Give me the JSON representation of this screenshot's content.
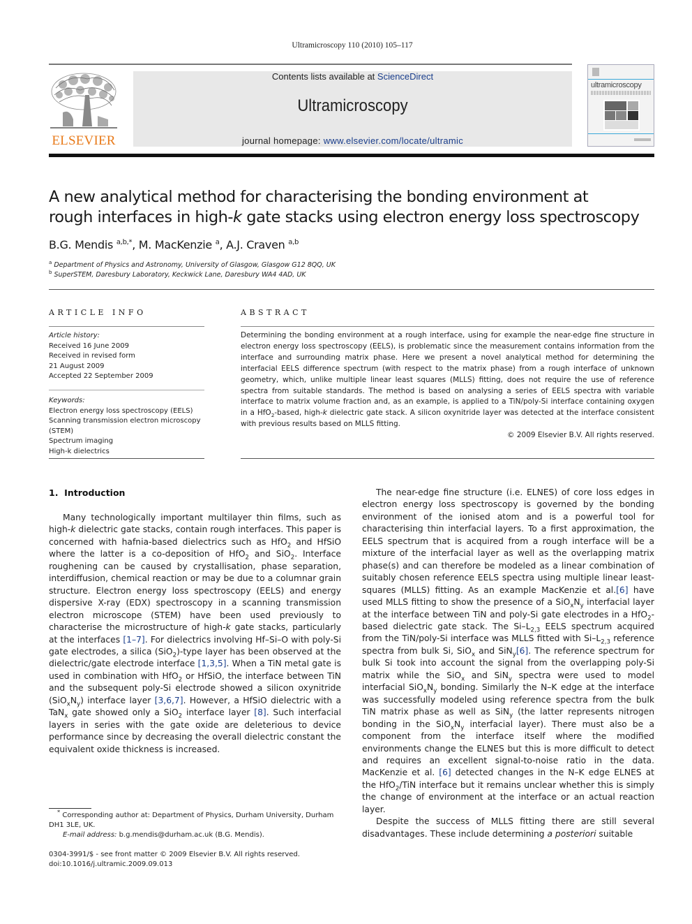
{
  "header": {
    "citation": "Ultramicroscopy 110 (2010) 105–117",
    "contents_prefix": "Contents lists available at ",
    "contents_link": "ScienceDirect",
    "journal_name": "Ultramicroscopy",
    "homepage_prefix": "journal homepage: ",
    "homepage_link": "www.elsevier.com/locate/ultramic",
    "publisher_logo_text": "ELSEVIER",
    "cover_title": "ultramicroscopy",
    "colors": {
      "link": "#1a3e8c",
      "elsevier_orange": "#e87a1a",
      "header_box": "#e8e8e8"
    }
  },
  "article": {
    "title_line1": "A new analytical method for characterising the bonding environment at",
    "title_line2_pre": "rough interfaces in high-",
    "title_line2_k": "k",
    "title_line2_post": " gate stacks using electron energy loss spectroscopy",
    "authors": [
      {
        "name": "B.G. Mendis",
        "sup": "a,b,*"
      },
      {
        "name": "M. MacKenzie",
        "sup": "a"
      },
      {
        "name": "A.J. Craven",
        "sup": "a,b"
      }
    ],
    "affiliations": [
      {
        "mark": "a",
        "text": "Department of Physics and Astronomy, University of Glasgow, Glasgow G12 8QQ, UK"
      },
      {
        "mark": "b",
        "text": "SuperSTEM, Daresbury Laboratory, Keckwick Lane, Daresbury WA4 4AD, UK"
      }
    ]
  },
  "article_info": {
    "heading": "ARTICLE INFO",
    "history_label": "Article history:",
    "history": [
      "Received 16 June 2009",
      "Received in revised form",
      "21 August 2009",
      "Accepted 22 September 2009"
    ],
    "keywords_label": "Keywords:",
    "keywords": [
      "Electron energy loss spectroscopy (EELS)",
      "Scanning transmission electron microscopy",
      "(STEM)",
      "Spectrum imaging",
      "High-k dielectrics"
    ]
  },
  "abstract": {
    "heading": "ABSTRACT",
    "part1": "Determining the bonding environment at a rough interface, using for example the near-edge fine structure in electron energy loss spectroscopy (EELS), is problematic since the measurement contains information from the interface and surrounding matrix phase. Here we present a novel analytical method for determining the interfacial EELS difference spectrum (with respect to the matrix phase) from a rough interface of unknown geometry, which, unlike multiple linear least squares (MLLS) fitting, does not require the use of reference spectra from suitable standards. The method is based on analysing a series of EELS spectra with variable interface to matrix volume fraction and, as an example, is applied to a TiN/poly-Si interface containing oxygen in a HfO",
    "part2": "-based, high-",
    "part3": " dielectric gate stack. A silicon oxynitride layer was detected at the interface consistent with previous results based on MLLS fitting.",
    "copyright": "© 2009 Elsevier B.V. All rights reserved."
  },
  "introduction": {
    "heading_number": "1.",
    "heading_title": "Introduction"
  },
  "footnotes": {
    "corresponding": "Corresponding author at: Department of Physics, Durham University, Durham DH1 3LE, UK.",
    "email_label": "E-mail address:",
    "email": "b.g.mendis@durham.ac.uk (B.G. Mendis).",
    "issn": "0304-3991/$ - see front matter © 2009 Elsevier B.V. All rights reserved.",
    "doi": "doi:10.1016/j.ultramic.2009.09.013"
  }
}
